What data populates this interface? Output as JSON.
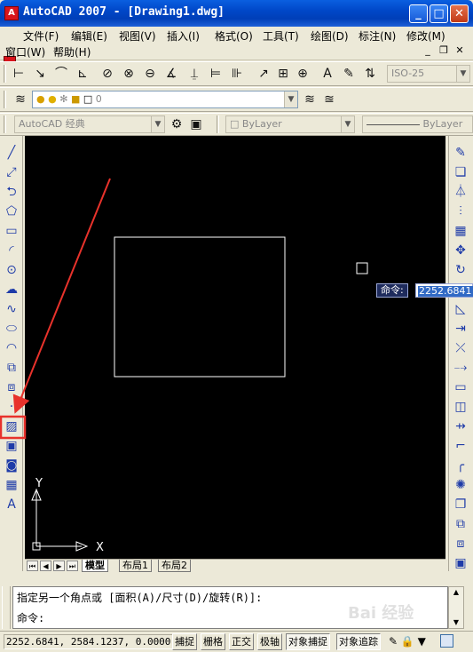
{
  "window": {
    "title": "AutoCAD 2007 - [Drawing1.dwg]",
    "min_label": "_",
    "max_label": "□",
    "close_label": "✕"
  },
  "menus": [
    {
      "label": "文件(F)"
    },
    {
      "label": "编辑(E)"
    },
    {
      "label": "视图(V)"
    },
    {
      "label": "插入(I)"
    },
    {
      "label": "格式(O)"
    },
    {
      "label": "工具(T)"
    },
    {
      "label": "绘图(D)"
    },
    {
      "label": "标注(N)"
    },
    {
      "label": "修改(M)"
    },
    {
      "label": "窗口(W)"
    },
    {
      "label": "帮助(H)"
    }
  ],
  "toolbars": {
    "dim_style": "ISO-25",
    "layer_value": "0",
    "workspace": "AutoCAD 经典",
    "color": "ByLayer",
    "linetype": "ByLayer",
    "lineweight": "ByLayer"
  },
  "left_tools": [
    {
      "icon": "line-icon",
      "glyph": "╱"
    },
    {
      "icon": "construction-line-icon",
      "glyph": "⤢"
    },
    {
      "icon": "polyline-icon",
      "glyph": "⮌"
    },
    {
      "icon": "polygon-icon",
      "glyph": "⬠"
    },
    {
      "icon": "rectangle-icon",
      "glyph": "▭"
    },
    {
      "icon": "arc-icon",
      "glyph": "◜"
    },
    {
      "icon": "circle-icon",
      "glyph": "⊙"
    },
    {
      "icon": "revision-cloud-icon",
      "glyph": "☁"
    },
    {
      "icon": "spline-icon",
      "glyph": "∿"
    },
    {
      "icon": "ellipse-icon",
      "glyph": "⬭"
    },
    {
      "icon": "ellipse-arc-icon",
      "glyph": "◠"
    },
    {
      "icon": "insert-block-icon",
      "glyph": "⧉"
    },
    {
      "icon": "make-block-icon",
      "glyph": "⧈"
    },
    {
      "icon": "point-icon",
      "glyph": "·"
    },
    {
      "icon": "hatch-icon",
      "glyph": "▨"
    },
    {
      "icon": "gradient-icon",
      "glyph": "▣"
    },
    {
      "icon": "region-icon",
      "glyph": "◙"
    },
    {
      "icon": "table-icon",
      "glyph": "▦"
    },
    {
      "icon": "multiline-text-icon",
      "glyph": "A"
    }
  ],
  "right_tools": [
    {
      "icon": "erase-icon",
      "glyph": "✎"
    },
    {
      "icon": "copy-icon",
      "glyph": "❏"
    },
    {
      "icon": "mirror-icon",
      "glyph": "⏃"
    },
    {
      "icon": "offset-icon",
      "glyph": "⫶"
    },
    {
      "icon": "array-icon",
      "glyph": "▦"
    },
    {
      "icon": "move-icon",
      "glyph": "✥"
    },
    {
      "icon": "rotate-icon",
      "glyph": "↻"
    },
    {
      "icon": "scale-icon",
      "glyph": "◺"
    },
    {
      "icon": "stretch-icon",
      "glyph": "⇥"
    },
    {
      "icon": "trim-icon",
      "glyph": "⤫"
    },
    {
      "icon": "extend-icon",
      "glyph": "⤍"
    },
    {
      "icon": "break-at-point-icon",
      "glyph": "▭"
    },
    {
      "icon": "break-icon",
      "glyph": "◫"
    },
    {
      "icon": "join-icon",
      "glyph": "⇸"
    },
    {
      "icon": "chamfer-icon",
      "glyph": "⌐"
    },
    {
      "icon": "fillet-icon",
      "glyph": "╭"
    },
    {
      "icon": "explode-icon",
      "glyph": "✺"
    },
    {
      "icon": "draw-order-icon",
      "glyph": "❐"
    },
    {
      "icon": "bring-to-front-icon",
      "glyph": "⧉"
    },
    {
      "icon": "send-to-back-icon",
      "glyph": "⧈"
    },
    {
      "icon": "bring-above-icon",
      "glyph": "▣"
    }
  ],
  "canvas": {
    "prompt_label": "命令:",
    "input_value": "2252.6841",
    "ucs_y": "Y",
    "ucs_x": "X"
  },
  "layout_tabs": [
    {
      "label": "模型"
    },
    {
      "label": "布局1"
    },
    {
      "label": "布局2"
    }
  ],
  "command": {
    "history_line": "指定另一个角点或 [面积(A)/尺寸(D)/旋转(R)]:",
    "prompt": "命令:"
  },
  "status": {
    "coordinates": "2252.6841, 2584.1237, 0.0000",
    "toggles": [
      "捕捉",
      "栅格",
      "正交",
      "极轴",
      "对象捕捉",
      "对象追踪"
    ],
    "active_toggles": [
      "对象捕捉",
      "对象追踪"
    ]
  },
  "watermark": "Bai 经验"
}
